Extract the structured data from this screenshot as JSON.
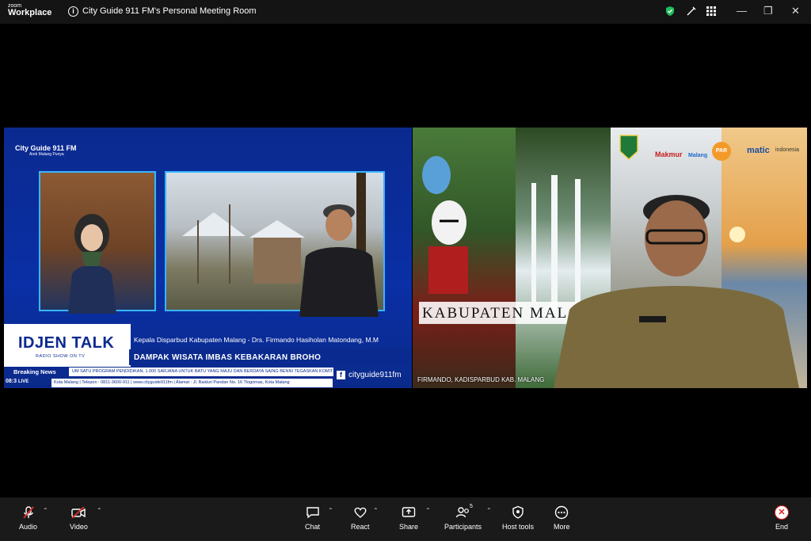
{
  "app": {
    "brand_small": "zoom",
    "brand_big": "Workplace",
    "room_title": "City Guide 911 FM's Personal Meeting Room"
  },
  "window_controls": {
    "minimize": "—",
    "maximize": "❐",
    "close": "✕"
  },
  "left_video": {
    "logo_text": "City Guide 911 FM",
    "logo_sub": "Arek Malang Punya",
    "show_title": "IDJEN TALK",
    "show_sub": "RADIO SHOW ON TV",
    "caption_line1": "Kepala Disparbud Kabupaten Malang - Drs. Firmando Hasiholan Matondang, M.M",
    "caption_line2": "DAMPAK WISATA IMBAS KEBAKARAN BROHO",
    "breaking_label": "Breaking News",
    "ticker_text": "UM SATU PROGRAM PENDIDIKAN, 1.000 SARJANA UNTUK BATU YANG MAJU DAN BERDAYA SAING  BENNI TEGASKAN KOMIT",
    "contact_text": "Kota Malang | Telepon : 0811-3600-911 | www.cityguide911fm | Alamat : Jl. Baiduri Pandan No. 16 Tlogomas, Kota Malang",
    "time_text": "08:3",
    "live_text": "LIVE",
    "social_text": "cityguide911fm"
  },
  "right_video": {
    "banner_text": "KABUPATEN MALAN",
    "name_tag": "FIRMANDO, KADISPARBUD KAB. MALANG",
    "logos": [
      "Makmur",
      "Malang",
      "PAR",
      "matic",
      "indonesia"
    ]
  },
  "toolbar": {
    "audio": "Audio",
    "video": "Video",
    "chat": "Chat",
    "react": "React",
    "share": "Share",
    "participants": "Participants",
    "participants_count": "5",
    "host_tools": "Host tools",
    "more": "More",
    "end": "End"
  },
  "colors": {
    "accent_blue": "#0b2a8f",
    "end_red": "#d22222",
    "shield_green": "#1fbf5a"
  }
}
